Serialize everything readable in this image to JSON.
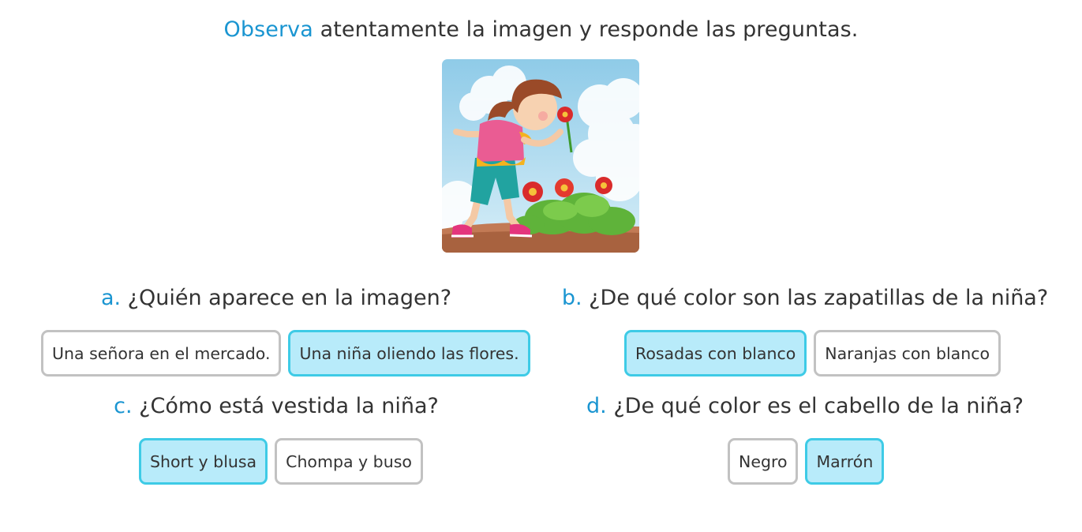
{
  "colors": {
    "accent": "#1a95d1",
    "selected_border": "#3ecbe6",
    "selected_bg": "#b8ebfa"
  },
  "instruction": {
    "highlight": "Observa",
    "rest": " atentamente la imagen y responde las preguntas."
  },
  "image": {
    "icon": "girl-smelling-flower-illustration"
  },
  "questions": [
    {
      "letter": "a.",
      "text": " ¿Quién aparece en la imagen?",
      "options": [
        {
          "label": "Una señora en el mercado.",
          "selected": false
        },
        {
          "label": "Una niña oliendo las flores.",
          "selected": true
        }
      ]
    },
    {
      "letter": "b.",
      "text": " ¿De qué color son las zapatillas de la niña?",
      "options": [
        {
          "label": "Rosadas con blanco",
          "selected": true
        },
        {
          "label": "Naranjas con blanco",
          "selected": false
        }
      ]
    },
    {
      "letter": "c.",
      "text": " ¿Cómo está vestida la niña?",
      "options": [
        {
          "label": "Short y blusa",
          "selected": true
        },
        {
          "label": "Chompa y buso",
          "selected": false
        }
      ]
    },
    {
      "letter": "d.",
      "text": " ¿De qué color es el cabello de la niña?",
      "options": [
        {
          "label": "Negro",
          "selected": false
        },
        {
          "label": "Marrón",
          "selected": true
        }
      ]
    }
  ]
}
